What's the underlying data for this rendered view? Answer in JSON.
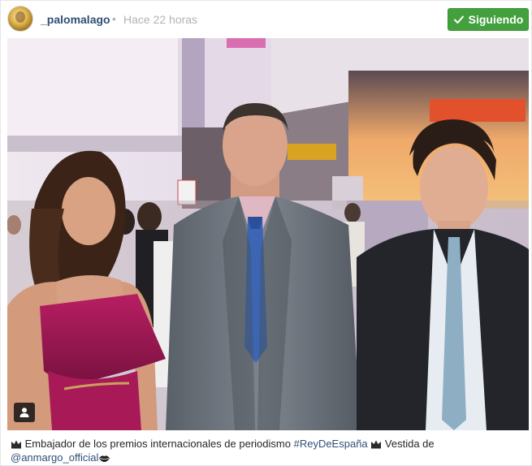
{
  "post": {
    "username": "_palomalago",
    "separator": "•",
    "time": "Hace 22 horas",
    "follow_label": "Siguiendo"
  },
  "caption": {
    "text_1": "Embajador de los premios internacionales de periodismo ",
    "hashtag": "#ReyDeEspaña",
    "text_2": "Vestida de",
    "mention": "@anmargo_official"
  },
  "photo": {
    "sign_left": "",
    "sign_right": ""
  },
  "colors": {
    "follow_green": "#43a13d",
    "link_blue": "#2f4f75",
    "muted_gray": "#b3b3b3"
  },
  "icons": {
    "check": "check-icon",
    "user_tag": "user-tag-icon",
    "crown": "crown-icon",
    "lips": "lips-icon"
  }
}
